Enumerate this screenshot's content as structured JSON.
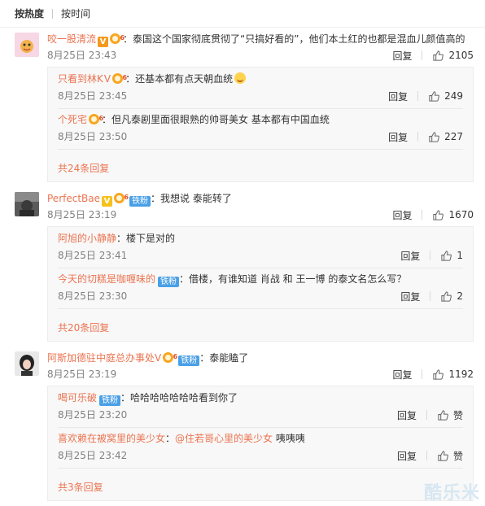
{
  "tabs": {
    "hot": "按热度",
    "time": "按时间"
  },
  "watermark": "酷乐米",
  "comments": [
    {
      "user": "咬一股清流",
      "text": "：泰国这个国家彻底贯彻了“只搞好看的”，他们本土红的也都是混血儿颜值高的",
      "time": "8月25日 23:43",
      "reply": "回复",
      "likes": "2105",
      "subs": [
        {
          "user": "只看到林K",
          "vmark": "V",
          "text": "：还基本都有点天朝血统",
          "time": "8月25日 23:45",
          "reply": "回复",
          "likes": "249"
        },
        {
          "user": "个死宅",
          "text": "：但凡泰剧里面很眼熟的帅哥美女 基本都有中国血统",
          "time": "8月25日 23:50",
          "reply": "回复",
          "likes": "227"
        }
      ],
      "more": "共24条回复"
    },
    {
      "user": "PerfectBae",
      "fan": "铁粉",
      "text": "：我想说 泰能转了",
      "time": "8月25日 23:19",
      "reply": "回复",
      "likes": "1670",
      "subs": [
        {
          "user": "阿旭的小静静",
          "text": "：楼下是对的",
          "time": "8月25日 23:41",
          "reply": "回复",
          "likes": "1"
        },
        {
          "user": "今天的切糕是咖喱味的",
          "fan": "铁粉",
          "text_a": "：借楼，有谁知道 ",
          "m1": "肖战",
          "text_b": " 和 ",
          "m2": "王一博",
          "text_c": " 的泰文名怎么写？",
          "time": "8月25日 23:30",
          "reply": "回复",
          "likes": "2"
        }
      ],
      "more": "共20条回复"
    },
    {
      "user": "阿斯加德驻中庭总办事处V",
      "fan": "铁粉",
      "text": "：泰能瞌了",
      "time": "8月25日 23:19",
      "reply": "回复",
      "likes": "1192",
      "subs": [
        {
          "user": "喝可乐破",
          "fan": "铁粉",
          "text": "：哈哈哈哈哈哈哈看到你了",
          "time": "8月25日 23:20",
          "reply": "回复",
          "likes": "赞"
        },
        {
          "user": "喜欢赖在被窝里的美少女",
          "text_a": "：",
          "m1": "@住若哥心里的美少女",
          "text_b": " 咦咦咦",
          "time": "8月25日 23:42",
          "reply": "回复",
          "likes": "赞"
        }
      ],
      "more": "共3条回复"
    }
  ]
}
